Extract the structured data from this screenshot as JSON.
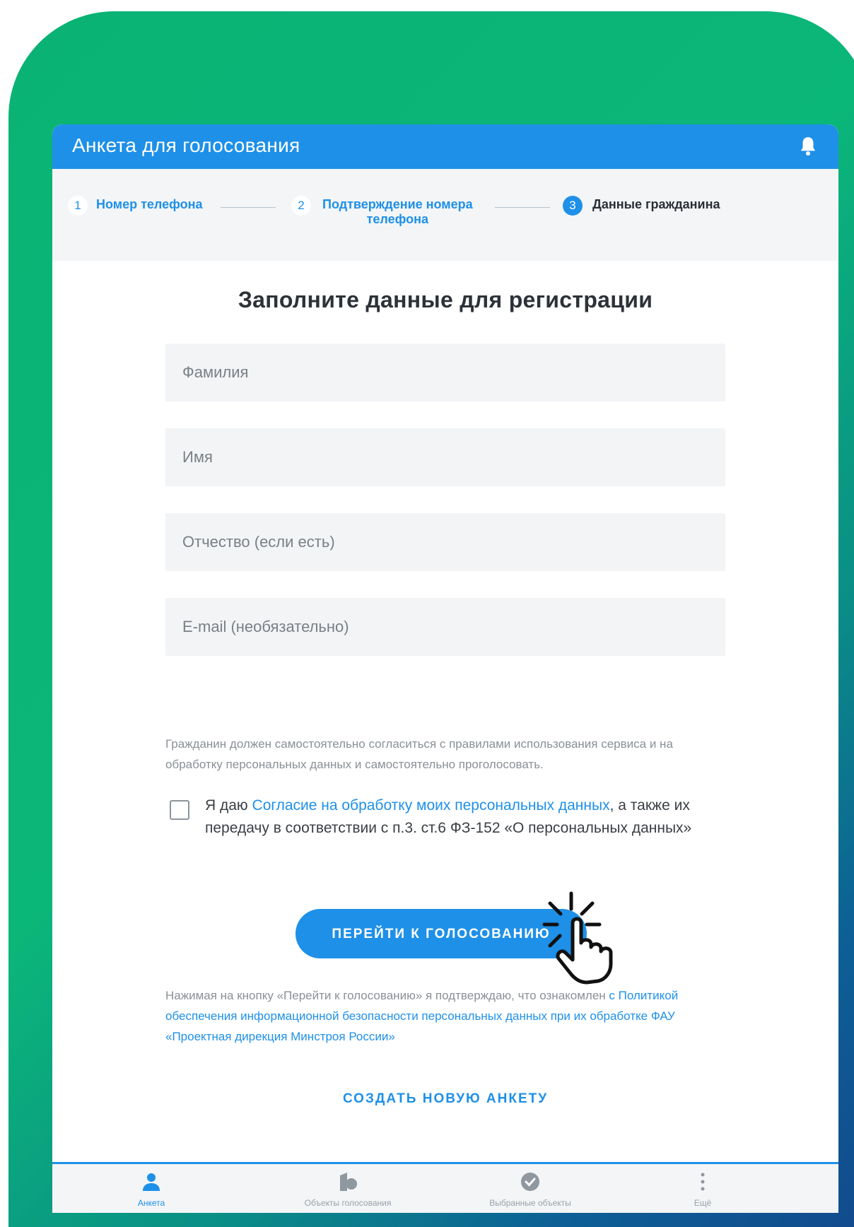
{
  "appbar": {
    "title": "Анкета для голосования"
  },
  "stepper": {
    "steps": [
      {
        "num": "1",
        "label": "Номер телефона"
      },
      {
        "num": "2",
        "label_line1": "Подтверждение номера",
        "label_line2": "телефона"
      },
      {
        "num": "3",
        "label": "Данные гражданина"
      }
    ],
    "active_step": 3
  },
  "form": {
    "title": "Заполните данные для регистрации",
    "fields": {
      "last_name": {
        "placeholder": "Фамилия",
        "value": ""
      },
      "first_name": {
        "placeholder": "Имя",
        "value": ""
      },
      "patronymic": {
        "placeholder": "Отчество (если есть)",
        "value": ""
      },
      "email": {
        "placeholder": "E-mail (необязательно)",
        "value": ""
      }
    },
    "notice": "Гражданин должен самостоятельно согласиться с правилами использования сервиса и на обработку персональных данных и самостоятельно проголосовать.",
    "consent": {
      "checked": false,
      "prefix": "Я даю ",
      "link": "Согласие на обработку моих персональных данных",
      "suffix": ", а также их передачу в соответствии с п.3. ст.6 ФЗ-152 «О персональных данных»"
    },
    "submit_label": "ПЕРЕЙТИ К ГОЛОСОВАНИЮ",
    "disclaimer_text": "Нажимая на кнопку «Перейти к голосованию» я подтверждаю, что ознакомлен ",
    "disclaimer_link": "с Политикой обеспечения информационной безопасности персональных данных при их обработке ФАУ «Проектная дирекция Минстроя России»",
    "create_new_label": "СОЗДАТЬ НОВУЮ АНКЕТУ"
  },
  "bottom_nav": {
    "items": [
      {
        "label": "Анкета",
        "icon": "person-icon",
        "active": true
      },
      {
        "label": "Объекты голосования",
        "icon": "building-icon",
        "active": false
      },
      {
        "label": "Выбранные объекты",
        "icon": "check-circle-icon",
        "active": false
      },
      {
        "label": "Ещё",
        "icon": "more-vertical-icon",
        "active": false
      }
    ]
  },
  "colors": {
    "primary": "#1e90e8",
    "gradient_green": "#0ab374",
    "gradient_blue": "#124a8d"
  }
}
